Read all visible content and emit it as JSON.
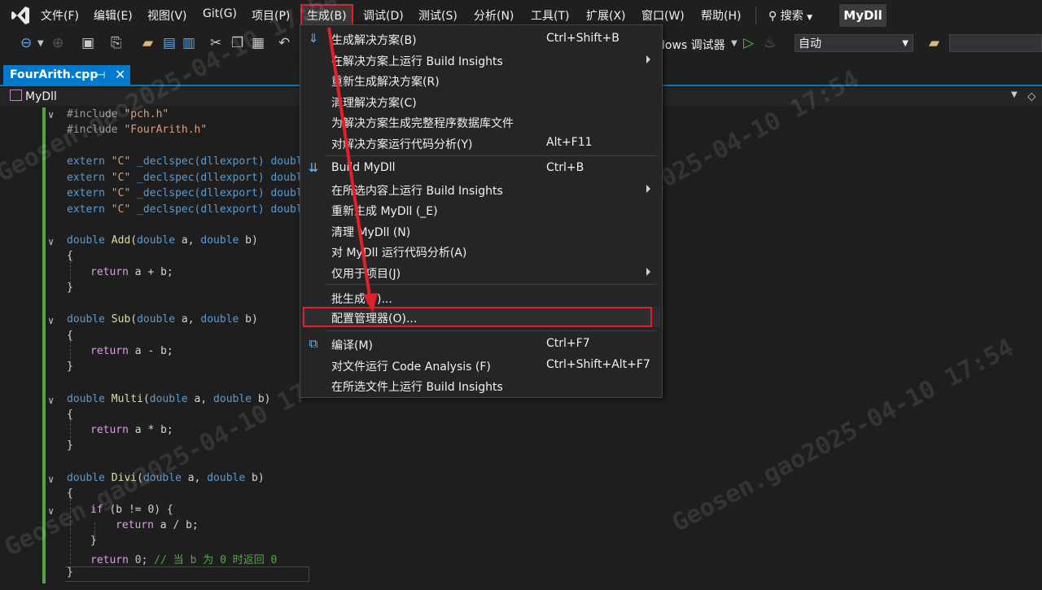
{
  "menubar": {
    "items": [
      "文件(F)",
      "编辑(E)",
      "视图(V)",
      "Git(G)",
      "项目(P)",
      "生成(B)",
      "调试(D)",
      "测试(S)",
      "分析(N)",
      "工具(T)",
      "扩展(X)",
      "窗口(W)",
      "帮助(H)"
    ],
    "search": "搜索",
    "solution": "MyDll"
  },
  "toolbar": {
    "debugger": "dows 调试器",
    "cpu": "自动"
  },
  "tab": {
    "title": "FourArith.cpp"
  },
  "navbar": {
    "project": "MyDll"
  },
  "code": {
    "l1_kw": "#include ",
    "l1_str": "\"pch.h\"",
    "l2_kw": "#include ",
    "l2_str": "\"FourArith.h\"",
    "extern_kw": "extern ",
    "extern_str": "\"C\"",
    "extern_rest": " _declspec(dllexport) double",
    "add_sig": "Add",
    "sub_sig": "Sub",
    "multi_sig": "Multi",
    "divi_sig": "Divi",
    "double": "double",
    "param_a": " a, ",
    "param_b": " b)",
    "open_brace": "{",
    "close_brace": "}",
    "ret_add": "a + b;",
    "ret_sub": "a - b;",
    "ret_mul": "a * b;",
    "ret_div": "a / b;",
    "return_kw": "return ",
    "if_kw": "if",
    "if_cond": " (b != 0) {",
    "ret_zero": "0",
    "comment": "// 当 b 为 0 时返回 0"
  },
  "build_menu": {
    "items": [
      {
        "label": "生成解决方案(B)",
        "shortcut": "Ctrl+Shift+B"
      },
      {
        "label": "在解决方案上运行 Build Insights",
        "shortcut": ""
      },
      {
        "label": "重新生成解决方案(R)",
        "shortcut": ""
      },
      {
        "label": "清理解决方案(C)",
        "shortcut": ""
      },
      {
        "label": "为解决方案生成完整程序数据库文件",
        "shortcut": ""
      },
      {
        "label": "对解决方案运行代码分析(Y)",
        "shortcut": "Alt+F11"
      },
      {
        "label": "Build MyDll",
        "shortcut": "Ctrl+B"
      },
      {
        "label": "在所选内容上运行 Build Insights",
        "shortcut": ""
      },
      {
        "label": "重新生成 MyDll (_E)",
        "shortcut": ""
      },
      {
        "label": "清理 MyDll (N)",
        "shortcut": ""
      },
      {
        "label": "对 MyDll 运行代码分析(A)",
        "shortcut": ""
      },
      {
        "label": "仅用于项目(J)",
        "shortcut": ""
      },
      {
        "label": "批生成(T)...",
        "shortcut": ""
      },
      {
        "label": "配置管理器(O)...",
        "shortcut": ""
      },
      {
        "label": "编译(M)",
        "shortcut": "Ctrl+F7"
      },
      {
        "label": "对文件运行 Code Analysis (F)",
        "shortcut": "Ctrl+Shift+Alt+F7"
      },
      {
        "label": "在所选文件上运行 Build Insights",
        "shortcut": ""
      }
    ]
  },
  "watermark": "Geosen.gao2025-04-10 17:54",
  "colors": {
    "accent": "#007acc",
    "highlight": "#e0202a",
    "change_bar": "#53a543"
  }
}
